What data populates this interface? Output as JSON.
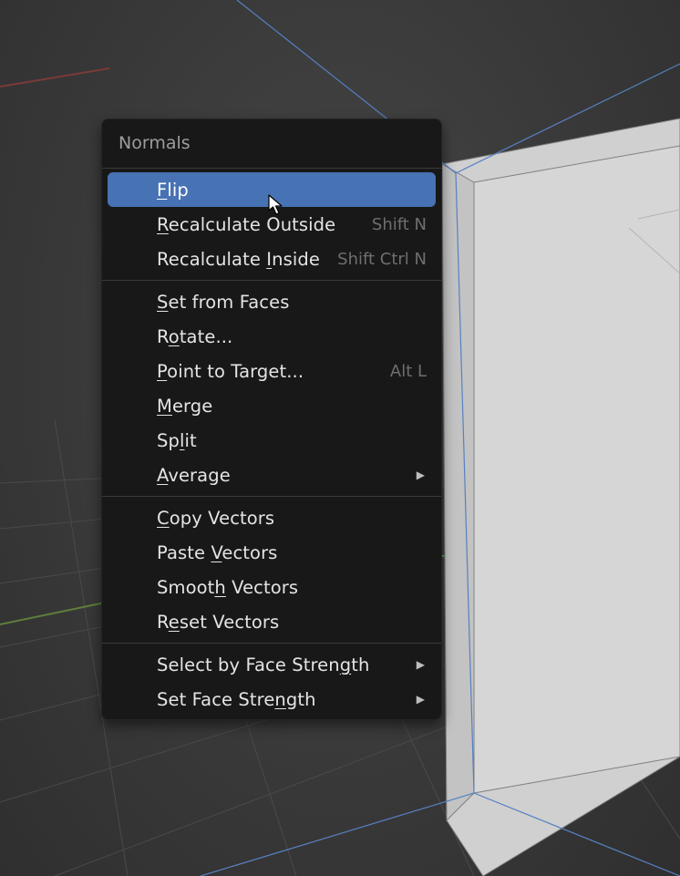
{
  "menu": {
    "title": "Normals",
    "group1": [
      {
        "label_pre": "",
        "accel": "F",
        "label_post": "lip",
        "shortcut": "",
        "submenu": false,
        "highlight": true
      },
      {
        "label_pre": "",
        "accel": "R",
        "label_post": "ecalculate Outside",
        "shortcut": "Shift N",
        "submenu": false,
        "highlight": false
      },
      {
        "label_pre": "Recalculate ",
        "accel": "I",
        "label_post": "nside",
        "shortcut": "Shift Ctrl N",
        "submenu": false,
        "highlight": false
      }
    ],
    "group2": [
      {
        "label_pre": "",
        "accel": "S",
        "label_post": "et from Faces",
        "shortcut": "",
        "submenu": false
      },
      {
        "label_pre": "R",
        "accel": "o",
        "label_post": "tate...",
        "shortcut": "",
        "submenu": false
      },
      {
        "label_pre": "",
        "accel": "P",
        "label_post": "oint to Target...",
        "shortcut": "Alt L",
        "submenu": false
      },
      {
        "label_pre": "",
        "accel": "M",
        "label_post": "erge",
        "shortcut": "",
        "submenu": false
      },
      {
        "label_pre": "Sp",
        "accel": "l",
        "label_post": "it",
        "shortcut": "",
        "submenu": false
      },
      {
        "label_pre": "",
        "accel": "A",
        "label_post": "verage",
        "shortcut": "",
        "submenu": true
      }
    ],
    "group3": [
      {
        "label_pre": "",
        "accel": "C",
        "label_post": "opy Vectors",
        "shortcut": "",
        "submenu": false
      },
      {
        "label_pre": "Paste ",
        "accel": "V",
        "label_post": "ectors",
        "shortcut": "",
        "submenu": false
      },
      {
        "label_pre": "Smoot",
        "accel": "h",
        "label_post": " Vectors",
        "shortcut": "",
        "submenu": false
      },
      {
        "label_pre": "R",
        "accel": "e",
        "label_post": "set Vectors",
        "shortcut": "",
        "submenu": false
      }
    ],
    "group4": [
      {
        "label_pre": "Select by Face Stren",
        "accel": "g",
        "label_post": "th",
        "shortcut": "",
        "submenu": true
      },
      {
        "label_pre": "Set Face Stre",
        "accel": "n",
        "label_post": "gth",
        "shortcut": "",
        "submenu": true
      }
    ]
  }
}
